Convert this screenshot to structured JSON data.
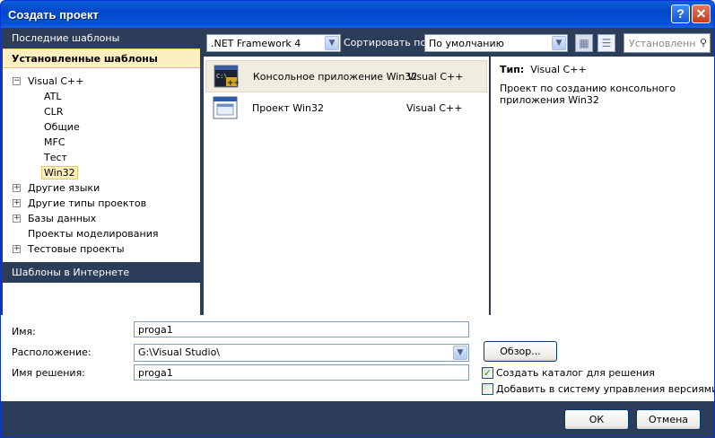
{
  "window": {
    "title": "Создать проект"
  },
  "left": {
    "recent_label": "Последние шаблоны",
    "installed_label": "Установленные шаблоны",
    "online_label": "Шаблоны в Интернете",
    "tree": {
      "visual_cpp": "Visual C++",
      "atl": "ATL",
      "clr": "CLR",
      "general": "Общие",
      "mfc": "MFC",
      "test": "Тест",
      "win32": "Win32",
      "other_langs": "Другие языки",
      "other_project_types": "Другие типы проектов",
      "databases": "Базы данных",
      "modeling": "Проекты моделирования",
      "test_projects": "Тестовые проекты"
    }
  },
  "toolbar": {
    "framework_value": ".NET Framework 4",
    "sort_label": "Сортировать по:",
    "sort_value": "По умолчанию",
    "search_placeholder": "Установленн"
  },
  "templates": [
    {
      "name": "Консольное приложение Win32",
      "lang": "Visual C++"
    },
    {
      "name": "Проект Win32",
      "lang": "Visual C++"
    }
  ],
  "details": {
    "type_label": "Тип:",
    "type_value": "Visual C++",
    "description": "Проект по созданию консольного приложения Win32"
  },
  "form": {
    "name_label": "Имя:",
    "name_value": "proga1",
    "location_label": "Расположение:",
    "location_value": "G:\\Visual Studio\\",
    "solution_label": "Имя решения:",
    "solution_value": "proga1",
    "browse_label": "Обзор...",
    "create_dir_label": "Создать каталог для решения",
    "add_vcs_label": "Добавить в систему управления версиями"
  },
  "footer": {
    "ok_label": "ОК",
    "cancel_label": "Отмена"
  },
  "colors": {
    "titlebar": "#0453d9",
    "panel": "#2c3d5a",
    "selection": "#fdefc0"
  }
}
